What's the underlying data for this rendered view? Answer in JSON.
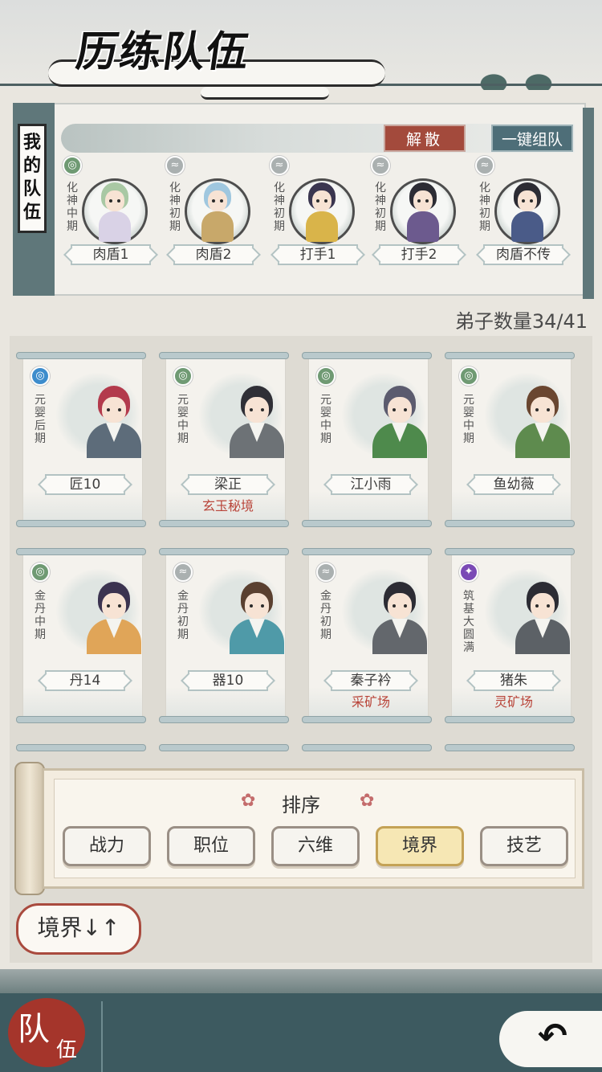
{
  "header": {
    "title": "历练队伍"
  },
  "team": {
    "label": "我的队伍",
    "dismiss_label": "解散",
    "auto_team_label": "一键组队",
    "members": [
      {
        "name": "肉盾1",
        "realm": "化神中期",
        "element": "water",
        "color": "#6f9a73"
      },
      {
        "name": "肉盾2",
        "realm": "化神初期",
        "element": "wind",
        "color": "#aab0b0"
      },
      {
        "name": "打手1",
        "realm": "化神初期",
        "element": "wind",
        "color": "#aab0b0"
      },
      {
        "name": "打手2",
        "realm": "化神初期",
        "element": "wind",
        "color": "#aab0b0"
      },
      {
        "name": "肉盾不传",
        "realm": "化神初期",
        "element": "wind",
        "color": "#aab0b0"
      }
    ]
  },
  "disciple_count": "弟子数量34/41",
  "disciples": [
    {
      "name": "匠10",
      "realm": "元婴后期",
      "location": "",
      "badge_color": "#3d8ccc",
      "hair": "#b33a4c",
      "robe": "#5d6c7a"
    },
    {
      "name": "梁正",
      "realm": "元婴中期",
      "location": "玄玉秘境",
      "badge_color": "#6f9a73",
      "hair": "#2f2f36",
      "robe": "#6d7276"
    },
    {
      "name": "江小雨",
      "realm": "元婴中期",
      "location": "",
      "badge_color": "#6f9a73",
      "hair": "#5b5b6e",
      "robe": "#4e8a4c"
    },
    {
      "name": "鱼幼薇",
      "realm": "元婴中期",
      "location": "",
      "badge_color": "#6f9a73",
      "hair": "#6a4630",
      "robe": "#5e8b4e"
    },
    {
      "name": "丹14",
      "realm": "金丹中期",
      "location": "",
      "badge_color": "#6f9a73",
      "hair": "#3b3350",
      "robe": "#e0a558"
    },
    {
      "name": "器10",
      "realm": "金丹初期",
      "location": "",
      "badge_color": "#aab0b0",
      "hair": "#5a4030",
      "robe": "#4f9aa8"
    },
    {
      "name": "秦子衿",
      "realm": "金丹初期",
      "location": "采矿场",
      "badge_color": "#aab0b0",
      "hair": "#2c2c34",
      "robe": "#63676c"
    },
    {
      "name": "猪朱",
      "realm": "筑基大圆满",
      "location": "灵矿场",
      "badge_color": "#7a4ab5",
      "hair": "#2c2c34",
      "robe": "#5c6166"
    }
  ],
  "sort": {
    "title": "排序",
    "options": [
      "战力",
      "职位",
      "六维",
      "境界",
      "技艺"
    ],
    "active": "境界"
  },
  "realm_sort_label": "境界↓↑",
  "tabs": {
    "team_char1": "队",
    "team_char2": "伍"
  },
  "icons": {
    "back": "back-arrow-icon",
    "flower": "flower-icon"
  }
}
